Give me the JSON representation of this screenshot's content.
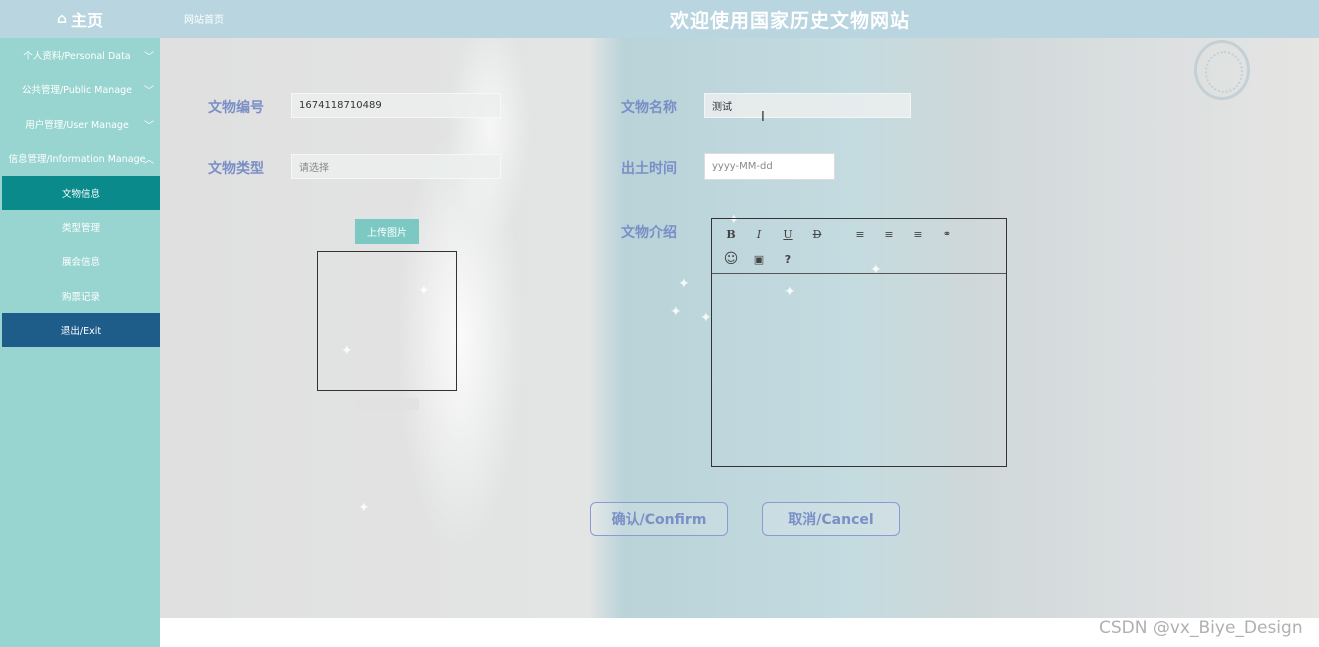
{
  "header": {
    "home_label": "主页",
    "home_icon": "home-icon",
    "breadcrumb": "网站首页",
    "site_title": "欢迎使用国家历史文物网站"
  },
  "sidebar": {
    "items": [
      {
        "label": "个人资料/Personal Data"
      },
      {
        "label": "公共管理/Public Manage"
      },
      {
        "label": "用户管理/User Manage"
      },
      {
        "label": "信息管理/Information Manage"
      },
      {
        "label": "文物信息"
      },
      {
        "label": "类型管理"
      },
      {
        "label": "展会信息"
      },
      {
        "label": "购票记录"
      },
      {
        "label": "退出/Exit"
      }
    ]
  },
  "form": {
    "id_label": "文物编号",
    "id_value": "1674118710489",
    "name_label": "文物名称",
    "name_value": "测试",
    "type_label": "文物类型",
    "type_placeholder": "请选择",
    "date_label": "出土时间",
    "date_placeholder": "yyyy-MM-dd",
    "upload_label": "上传图片",
    "intro_label": "文物介绍",
    "confirm_label": "确认/Confirm",
    "cancel_label": "取消/Cancel"
  },
  "editor": {
    "tools": [
      "B",
      "I",
      "U",
      "D",
      "≡",
      "≡",
      "≡",
      "🔗",
      "☺",
      "▣",
      "?"
    ]
  },
  "watermark": "CSDN @vx_Biye_Design",
  "colors": {
    "header_bg": "#b8d5e0",
    "sidebar_bg": "#99d5d0",
    "active_item": "#0b8a8c",
    "exit_item": "#1e5c8a",
    "label_color": "#7b8fc7",
    "upload_button": "#7cc9c4"
  }
}
